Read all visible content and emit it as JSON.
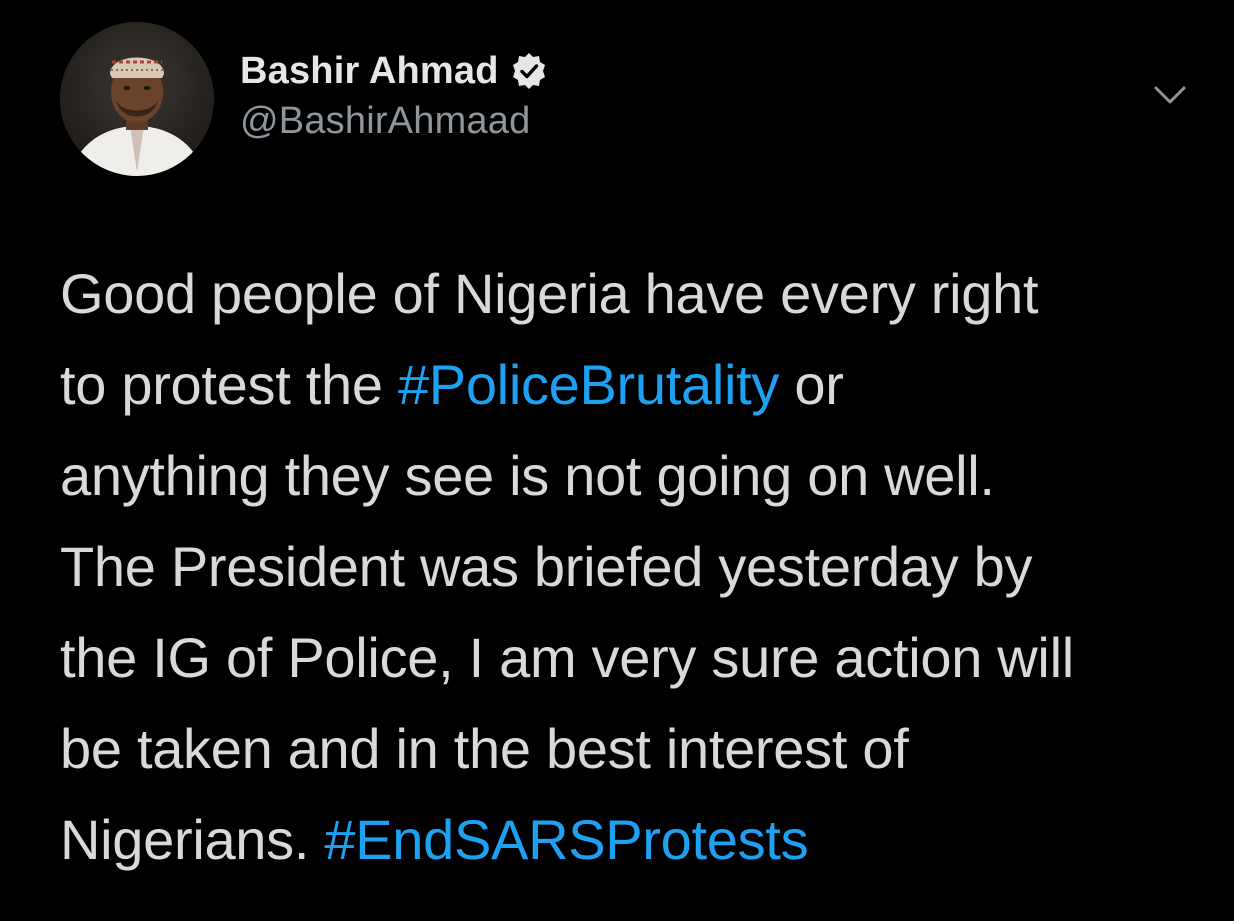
{
  "author": {
    "display_name": "Bashir Ahmad",
    "handle": "@BashirAhmaad",
    "verified": true,
    "avatar_icon": "profile-photo"
  },
  "menu": {
    "icon": "chevron-down-icon"
  },
  "tweet": {
    "lines": [
      [
        "Good people of Nigeria have every right"
      ],
      [
        "to protest the ",
        "#PoliceBrutality",
        " or"
      ],
      [
        "anything they see is not going on well."
      ],
      [
        "The President was briefed yesterday by"
      ],
      [
        "the IG of Police, I am very sure action will"
      ],
      [
        "be taken and in the best interest of"
      ],
      [
        "Nigerians. ",
        "#EndSARSProtests"
      ]
    ]
  },
  "colors": {
    "background": "#000000",
    "text": "#d9d9d9",
    "handle": "#8e959b",
    "hashtag": "#1da1f2"
  }
}
